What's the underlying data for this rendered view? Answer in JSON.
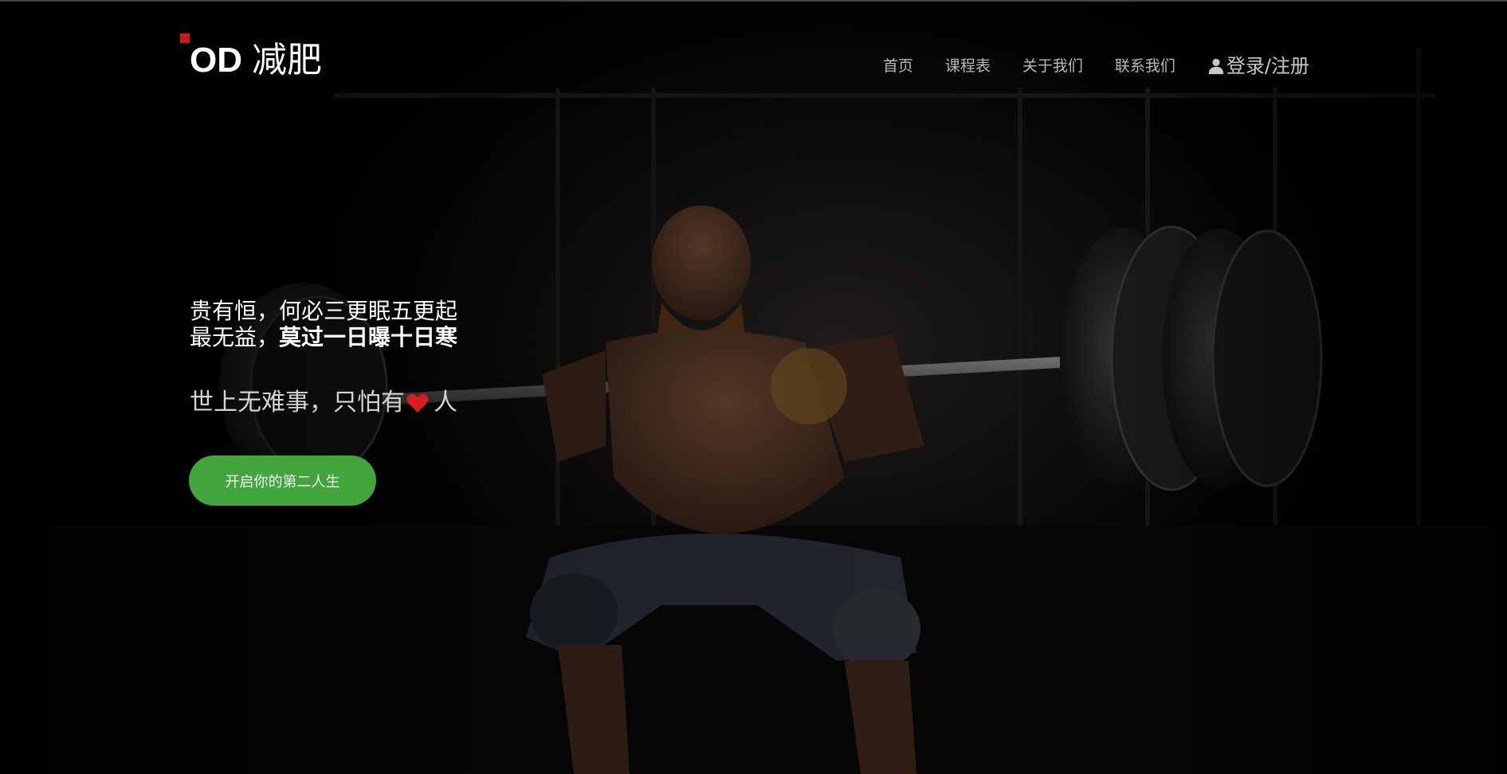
{
  "header": {
    "logo_brand": "OD",
    "logo_text": "减肥",
    "nav": [
      {
        "label": "首页"
      },
      {
        "label": "课程表"
      },
      {
        "label": "关于我们"
      },
      {
        "label": "联系我们"
      }
    ],
    "login_label": "登录/注册"
  },
  "hero": {
    "line1": "贵有恒，何必三更眠五更起",
    "line2_prefix": "最无益，",
    "line2_bold": "莫过一日曝十日寒",
    "sub_prefix": "世上无难事，只怕有",
    "sub_suffix": "人",
    "cta_label": "开启你的第二人生"
  },
  "colors": {
    "accent_red": "#d4141c",
    "cta_green": "#43a53e",
    "heart": "#d81e1e"
  },
  "icons": [
    "user-icon",
    "heart-icon"
  ]
}
